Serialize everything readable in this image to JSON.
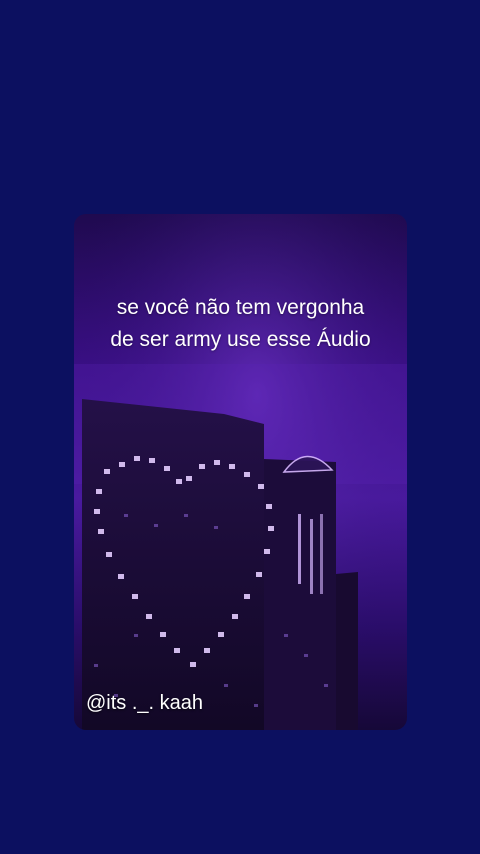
{
  "background_color": "#0c1060",
  "card": {
    "caption_line1": "se você não tem vergonha",
    "caption_line2": "de ser army use esse Áudio",
    "watermark": "@its ._. kaah",
    "accent_color": "#b68cff"
  }
}
